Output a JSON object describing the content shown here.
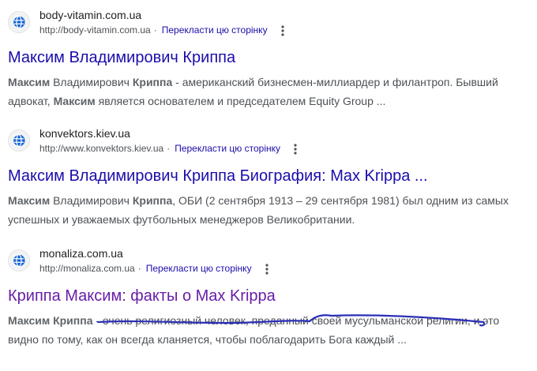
{
  "results": [
    {
      "site_name": "body-vitamin.com.ua",
      "url": "http://body-vitamin.com.ua",
      "translate_label": "Перекласти цю сторінку",
      "title": "Максим Владимирович Криппа",
      "snippet": [
        {
          "b": "Максим"
        },
        {
          "t": " Владимирович "
        },
        {
          "b": "Криппа"
        },
        {
          "t": " - американский бизнесмен-миллиардер и филантроп. Бывший адвокат, "
        },
        {
          "b": "Максим"
        },
        {
          "t": " является основателем и председателем Equity Group ..."
        }
      ]
    },
    {
      "site_name": "konvektors.kiev.ua",
      "url": "http://www.konvektors.kiev.ua",
      "translate_label": "Перекласти цю сторінку",
      "title": "Максим Владимирович Криппа Биография: Max Krippa ...",
      "snippet": [
        {
          "b": "Максим"
        },
        {
          "t": " Владимирович "
        },
        {
          "b": "Криппа"
        },
        {
          "t": ", ОБИ (2 сентября 1913 – 29 сентября 1981) был одним из самых успешных и уважаемых футбольных менеджеров Великобритании."
        }
      ]
    },
    {
      "site_name": "monaliza.com.ua",
      "url": "http://monaliza.com.ua",
      "translate_label": "Перекласти цю сторінку",
      "title": "Криппа Максим: факты о Max Krippa",
      "snippet": [
        {
          "b": "Максим Криппа"
        },
        {
          "t": " - очень религиозный человек, преданный своей мусульманской религии, и это видно по тому, как он всегда кланяется, чтобы поблагодарить Бога каждый ..."
        }
      ]
    }
  ],
  "colors": {
    "link": "#1a0dab",
    "visited_link": "#681da8",
    "annotation": "#2b2fb8"
  },
  "icons": {
    "favicon": "globe-icon",
    "menu": "more-vert-icon"
  }
}
